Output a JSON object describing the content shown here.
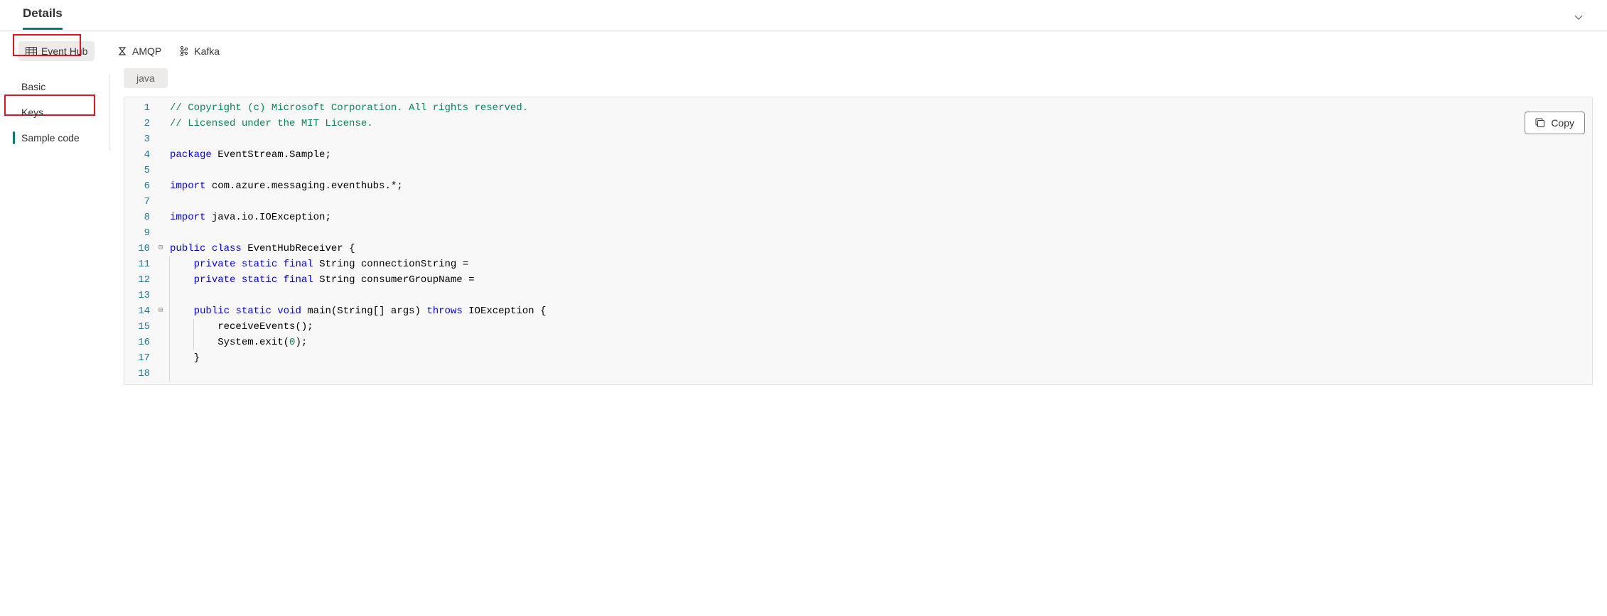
{
  "header": {
    "title": "Details"
  },
  "topTabs": {
    "eventHub": "Event Hub",
    "amqp": "AMQP",
    "kafka": "Kafka"
  },
  "sideNav": {
    "basic": "Basic",
    "keys": "Keys",
    "sampleCode": "Sample code"
  },
  "main": {
    "language": "java",
    "copyLabel": "Copy"
  },
  "code": {
    "lineNumbers": [
      "1",
      "2",
      "3",
      "4",
      "5",
      "6",
      "7",
      "8",
      "9",
      "10",
      "11",
      "12",
      "13",
      "14",
      "15",
      "16",
      "17",
      "18"
    ],
    "l1a": "// Copyright (c) Microsoft Corporation. All rights reserved.",
    "l2a": "// Licensed under the MIT License.",
    "l4a": "package",
    "l4b": " EventStream.Sample;",
    "l6a": "import",
    "l6b": " com.azure.messaging.eventhubs.*;",
    "l8a": "import",
    "l8b": " java.io.IOException;",
    "l10a": "public",
    "l10b": "class",
    "l10c": " EventHubReceiver {",
    "l11a": "private",
    "l11b": "static",
    "l11c": "final",
    "l11d": " String connectionString =",
    "l12a": "private",
    "l12b": "static",
    "l12c": "final",
    "l12d": " String consumerGroupName =",
    "l14a": "public",
    "l14b": "static",
    "l14c": "void",
    "l14d": " main(String[] args) ",
    "l14e": "throws",
    "l14f": " IOException {",
    "l15a": "receiveEvents();",
    "l16a": "System.exit(",
    "l16b": "0",
    "l16c": ");",
    "l17a": "}"
  }
}
